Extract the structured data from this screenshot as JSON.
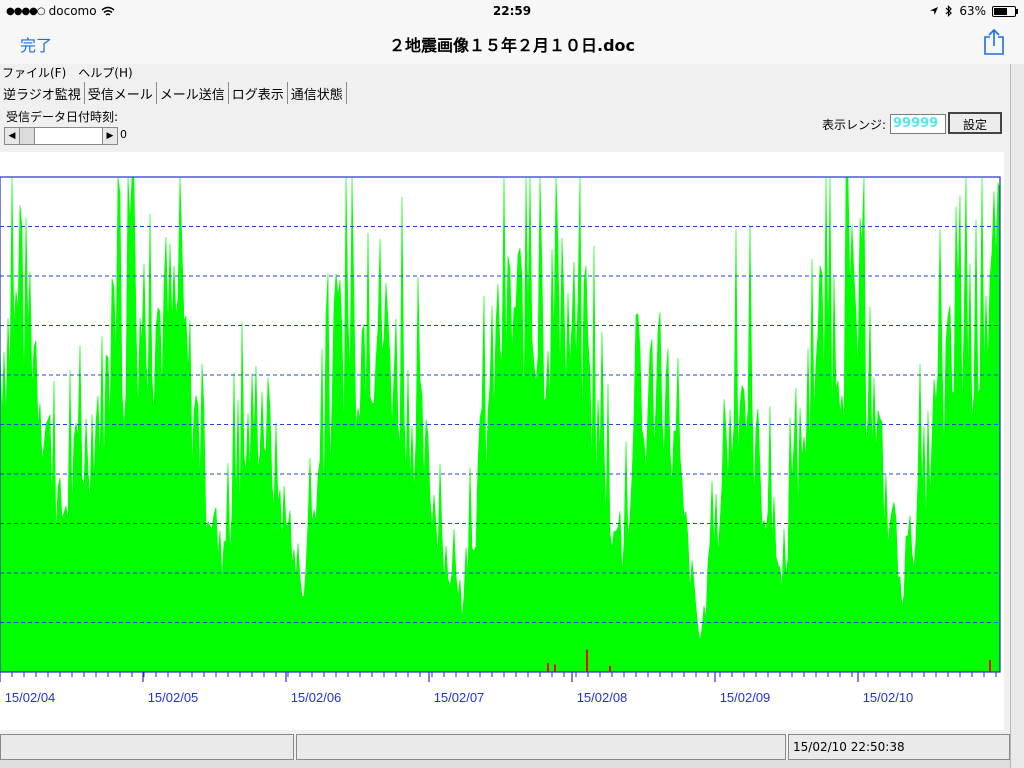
{
  "status_bar": {
    "carrier": "docomo",
    "signal_dots": "●●●●○",
    "time": "22:59",
    "battery": "63%",
    "battery_level": 0.63
  },
  "nav": {
    "done_label": "完了",
    "title": "２地震画像１５年２月１０日.doc"
  },
  "app": {
    "menu": [
      "ファイル(F)",
      "ヘルプ(H)"
    ],
    "tabs": [
      "逆ラジオ監視",
      "受信メール",
      "メール送信",
      "ログ表示",
      "通信状態"
    ],
    "received_time_label": "受信データ日付時刻:",
    "scroll_value": "0",
    "range_label": "表示レンジ:",
    "range_value": "99999",
    "set_button": "設定",
    "status_pane_text": "15/02/10 22:50:38"
  },
  "chart_data": {
    "type": "area",
    "x_tick_labels": [
      "15/02/04",
      "15/02/05",
      "15/02/06",
      "15/02/07",
      "15/02/08",
      "15/02/09",
      "15/02/10"
    ],
    "grid": true,
    "ylim": [
      0,
      99999
    ],
    "series": [
      {
        "color": "#00ff00",
        "x": [
          0,
          0.03,
          0.06,
          0.1,
          0.14,
          0.18,
          0.22,
          0.26,
          0.3,
          0.34,
          0.38,
          0.42,
          0.46,
          0.5,
          0.54,
          0.58,
          0.62,
          0.66,
          0.7,
          0.74,
          0.78,
          0.82,
          0.86,
          0.9,
          0.94,
          0.98,
          1.0
        ],
        "values": [
          85000,
          95000,
          40000,
          70000,
          95000,
          90000,
          30000,
          72000,
          20000,
          85000,
          92000,
          60000,
          15000,
          90000,
          95000,
          85000,
          30000,
          85000,
          8000,
          80000,
          25000,
          88000,
          92000,
          20000,
          70000,
          95000,
          99999
        ]
      },
      {
        "color": "#ff0000",
        "x": [
          0.548,
          0.555,
          0.587,
          0.61,
          0.99
        ],
        "values": [
          1800,
          1500,
          4500,
          1200,
          2400
        ]
      }
    ]
  }
}
